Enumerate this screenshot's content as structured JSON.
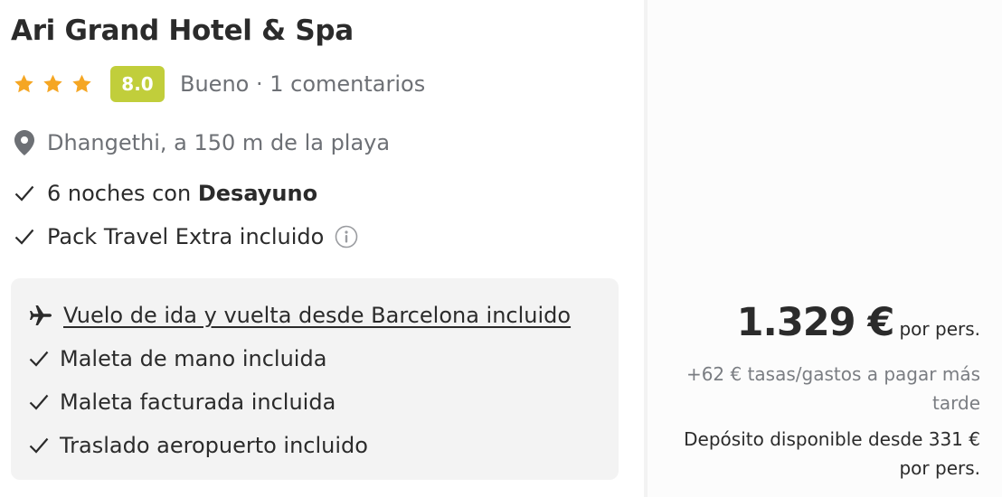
{
  "hotel": {
    "name": "Ari Grand Hotel & Spa",
    "stars": 3,
    "score": "8.0",
    "reviews": "Bueno · 1 comentarios",
    "location": "Dhangethi, a 150 m de la playa"
  },
  "features": {
    "nights_prefix": "6 noches con ",
    "nights_bold": "Desayuno",
    "pack": "Pack Travel Extra incluido"
  },
  "flight": {
    "link": "Vuelo de ida y vuelta desde Barcelona incluido",
    "items": [
      "Maleta de mano incluida",
      "Maleta facturada incluida",
      "Traslado aeropuerto incluido"
    ]
  },
  "pricing": {
    "price": "1.329 €",
    "per": "por pers.",
    "taxes": "+62 € tasas/gastos a pagar más tarde",
    "deposit": "Depósito disponible desde 331 € por pers."
  },
  "colors": {
    "star": "#f5a623",
    "score_bg": "#c1ce3b",
    "muted": "#6d7075",
    "box_bg": "#f3f3f3"
  },
  "icons": [
    "star-icon",
    "map-pin-icon",
    "check-icon",
    "info-icon",
    "plane-icon"
  ]
}
